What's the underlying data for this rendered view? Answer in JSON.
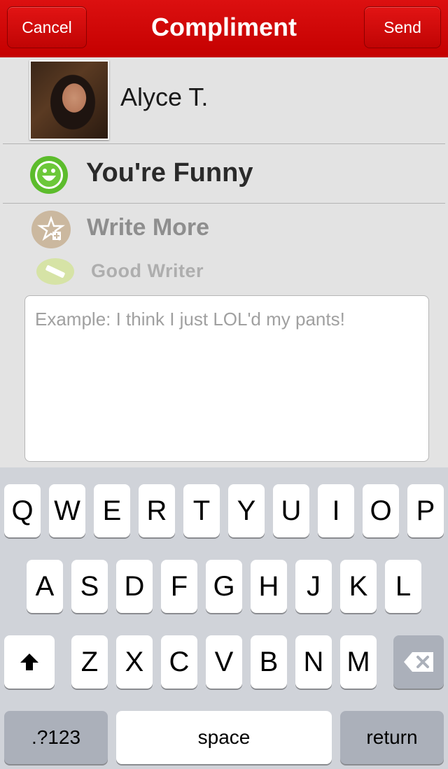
{
  "header": {
    "title": "Compliment",
    "cancel_label": "Cancel",
    "send_label": "Send"
  },
  "recipient": {
    "name": "Alyce T."
  },
  "compliment": {
    "selected": "You're Funny",
    "write_more": "Write More",
    "good_writer": "Good Writer"
  },
  "message": {
    "placeholder": "Example: I think I just LOL'd my pants!",
    "value": ""
  },
  "keyboard": {
    "row1": [
      "Q",
      "W",
      "E",
      "R",
      "T",
      "Y",
      "U",
      "I",
      "O",
      "P"
    ],
    "row2": [
      "A",
      "S",
      "D",
      "F",
      "G",
      "H",
      "J",
      "K",
      "L"
    ],
    "row3": [
      "Z",
      "X",
      "C",
      "V",
      "B",
      "N",
      "M"
    ],
    "numbers_label": ".?123",
    "space_label": "space",
    "return_label": "return"
  },
  "colors": {
    "header_red": "#d00808",
    "funny_green": "#5cbc2c",
    "keyboard_bg": "#d0d3d9"
  }
}
